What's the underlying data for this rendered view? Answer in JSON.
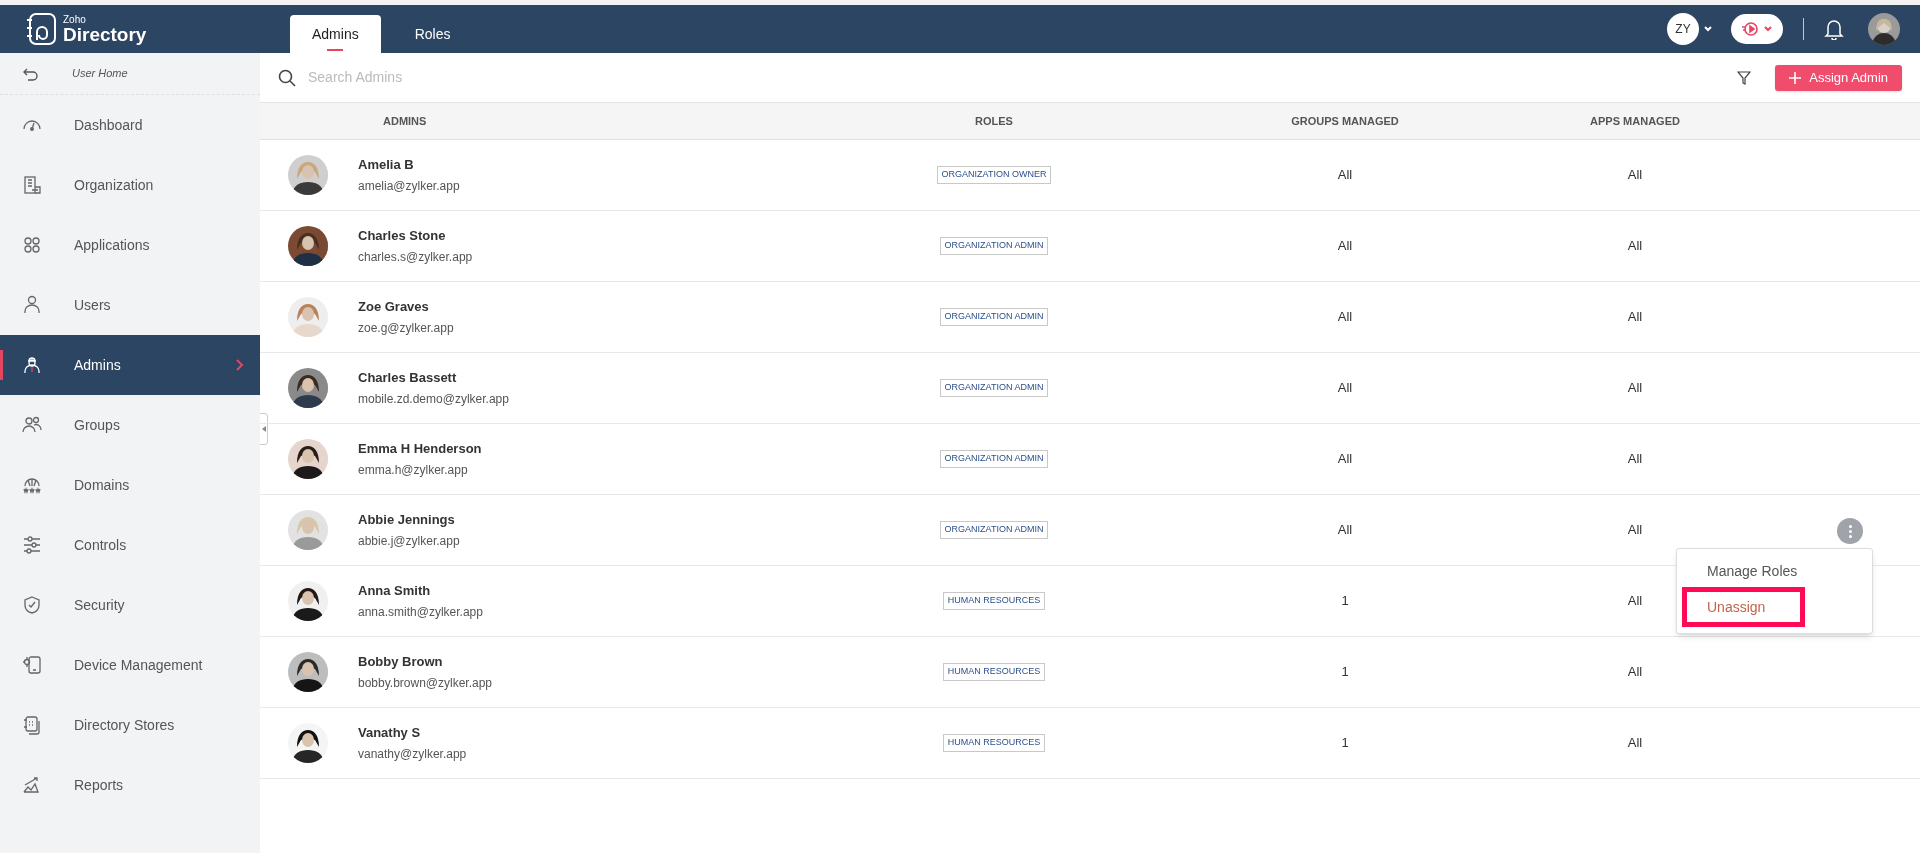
{
  "app": {
    "brand_small": "Zoho",
    "brand": "Directory"
  },
  "tabs": [
    {
      "label": "Admins",
      "selected": true
    },
    {
      "label": "Roles",
      "selected": false
    }
  ],
  "header": {
    "org_initials": "ZY"
  },
  "sidebar": {
    "back_link": "User Home",
    "items": [
      {
        "label": "Dashboard",
        "selected": false
      },
      {
        "label": "Organization",
        "selected": false
      },
      {
        "label": "Applications",
        "selected": false
      },
      {
        "label": "Users",
        "selected": false
      },
      {
        "label": "Admins",
        "selected": true
      },
      {
        "label": "Groups",
        "selected": false
      },
      {
        "label": "Domains",
        "selected": false
      },
      {
        "label": "Controls",
        "selected": false
      },
      {
        "label": "Security",
        "selected": false
      },
      {
        "label": "Device Management",
        "selected": false
      },
      {
        "label": "Directory Stores",
        "selected": false
      },
      {
        "label": "Reports",
        "selected": false
      }
    ]
  },
  "search": {
    "placeholder": "Search Admins"
  },
  "assign_button": "Assign Admin",
  "table": {
    "columns": [
      "ADMINS",
      "ROLES",
      "GROUPS MANAGED",
      "APPS MANAGED"
    ],
    "rows": [
      {
        "name": "Amelia B",
        "email": "amelia@zylker.app",
        "role": "ORGANIZATION OWNER",
        "groups": "All",
        "apps": "All",
        "menu_open": false
      },
      {
        "name": "Charles Stone",
        "email": "charles.s@zylker.app",
        "role": "ORGANIZATION ADMIN",
        "groups": "All",
        "apps": "All",
        "menu_open": false
      },
      {
        "name": "Zoe Graves",
        "email": "zoe.g@zylker.app",
        "role": "ORGANIZATION ADMIN",
        "groups": "All",
        "apps": "All",
        "menu_open": false
      },
      {
        "name": "Charles Bassett",
        "email": "mobile.zd.demo@zylker.app",
        "role": "ORGANIZATION ADMIN",
        "groups": "All",
        "apps": "All",
        "menu_open": false
      },
      {
        "name": "Emma H Henderson",
        "email": "emma.h@zylker.app",
        "role": "ORGANIZATION ADMIN",
        "groups": "All",
        "apps": "All",
        "menu_open": false
      },
      {
        "name": "Abbie Jennings",
        "email": "abbie.j@zylker.app",
        "role": "ORGANIZATION ADMIN",
        "groups": "All",
        "apps": "All",
        "menu_open": true
      },
      {
        "name": "Anna Smith",
        "email": "anna.smith@zylker.app",
        "role": "HUMAN RESOURCES",
        "groups": "1",
        "apps": "All",
        "menu_open": false
      },
      {
        "name": "Bobby Brown",
        "email": "bobby.brown@zylker.app",
        "role": "HUMAN RESOURCES",
        "groups": "1",
        "apps": "All",
        "menu_open": false
      },
      {
        "name": "Vanathy S",
        "email": "vanathy@zylker.app",
        "role": "HUMAN RESOURCES",
        "groups": "1",
        "apps": "All",
        "menu_open": false
      }
    ]
  },
  "row_menu": [
    {
      "label": "Manage Roles",
      "kind": "normal",
      "highlighted": false
    },
    {
      "label": "Unassign",
      "kind": "danger",
      "highlighted": true
    }
  ]
}
